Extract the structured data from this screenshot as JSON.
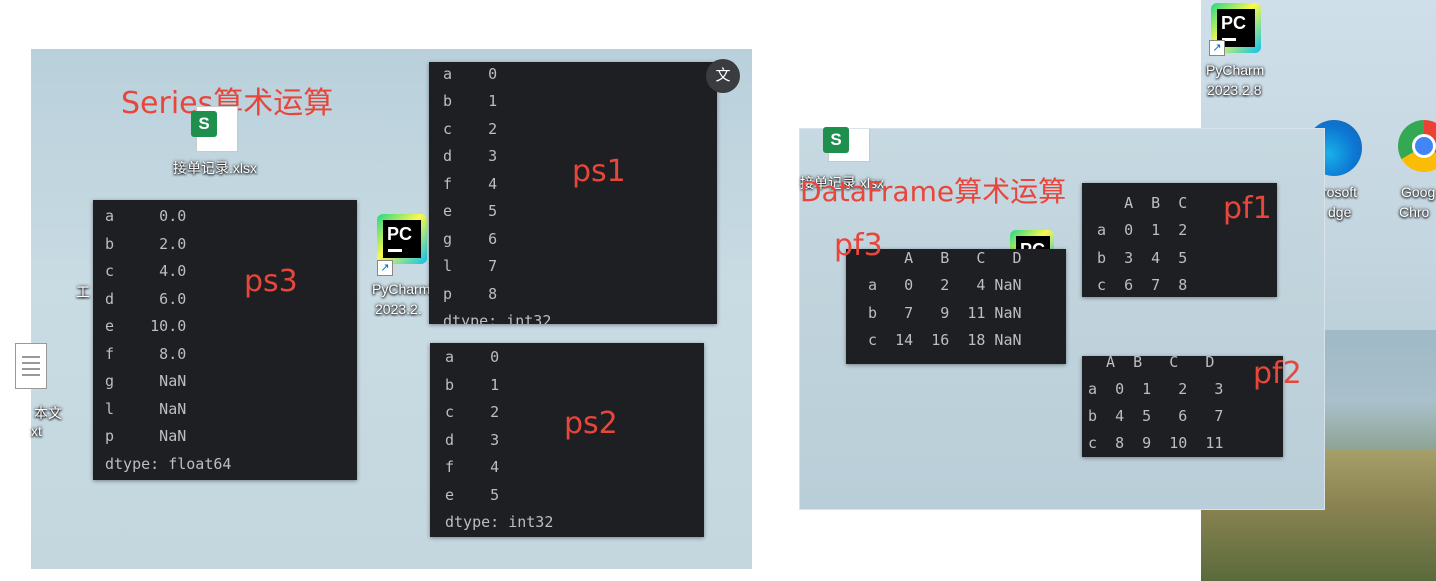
{
  "left_window": {
    "heading": "Series算术运算",
    "translate_icon_label": "文",
    "desktop_icons": {
      "xlsx_name": "接单记录.xlsx",
      "pycharm_name": "PyCharm",
      "pycharm_version": "2023.2.",
      "partial_label_a": "本文",
      "partial_label_b": "xt",
      "partial_label_c": "工"
    },
    "ps1": {
      "label": "ps1",
      "rows": [
        "a    0",
        "b    1",
        "c    2",
        "d    3",
        "f    4",
        "e    5",
        "g    6",
        "l    7",
        "p    8",
        "dtype: int32"
      ]
    },
    "ps2": {
      "label": "ps2",
      "rows": [
        "a    0",
        "b    1",
        "c    2",
        "d    3",
        "f    4",
        "e    5",
        "dtype: int32"
      ]
    },
    "ps3": {
      "label": "ps3",
      "rows": [
        "a     0.0",
        "b     2.0",
        "c     4.0",
        "d     6.0",
        "e    10.0",
        "f     8.0",
        "g     NaN",
        "l     NaN",
        "p     NaN",
        "dtype: float64"
      ]
    }
  },
  "right_window": {
    "heading": "DataFrame算术运算",
    "xlsx_name": "接单记录.xlsx",
    "pf1": {
      "label": "pf1",
      "rows": [
        "   A  B  C",
        "a  0  1  2",
        "b  3  4  5",
        "c  6  7  8"
      ]
    },
    "pf2": {
      "label": "pf2",
      "rows": [
        "  A  B   C   D",
        "a  0  1   2   3",
        "b  4  5   6   7",
        "c  8  9  10  11"
      ]
    },
    "pf3": {
      "label": "pf3",
      "rows": [
        "    A   B   C   D",
        "a   0   2   4 NaN",
        "b   7   9  11 NaN",
        "c  14  16  18 NaN"
      ]
    }
  },
  "far_right_desktop": {
    "pycharm_name": "PyCharm",
    "pycharm_version": "2023.2.8",
    "edge_label_a": "rosoft",
    "edge_label_b": "dge",
    "chrome_label_a": "Goog",
    "chrome_label_b": "Chro"
  },
  "colors": {
    "accent_red": "#e8463b",
    "terminal_bg": "#1e1f22",
    "terminal_fg": "#bcbec4"
  }
}
